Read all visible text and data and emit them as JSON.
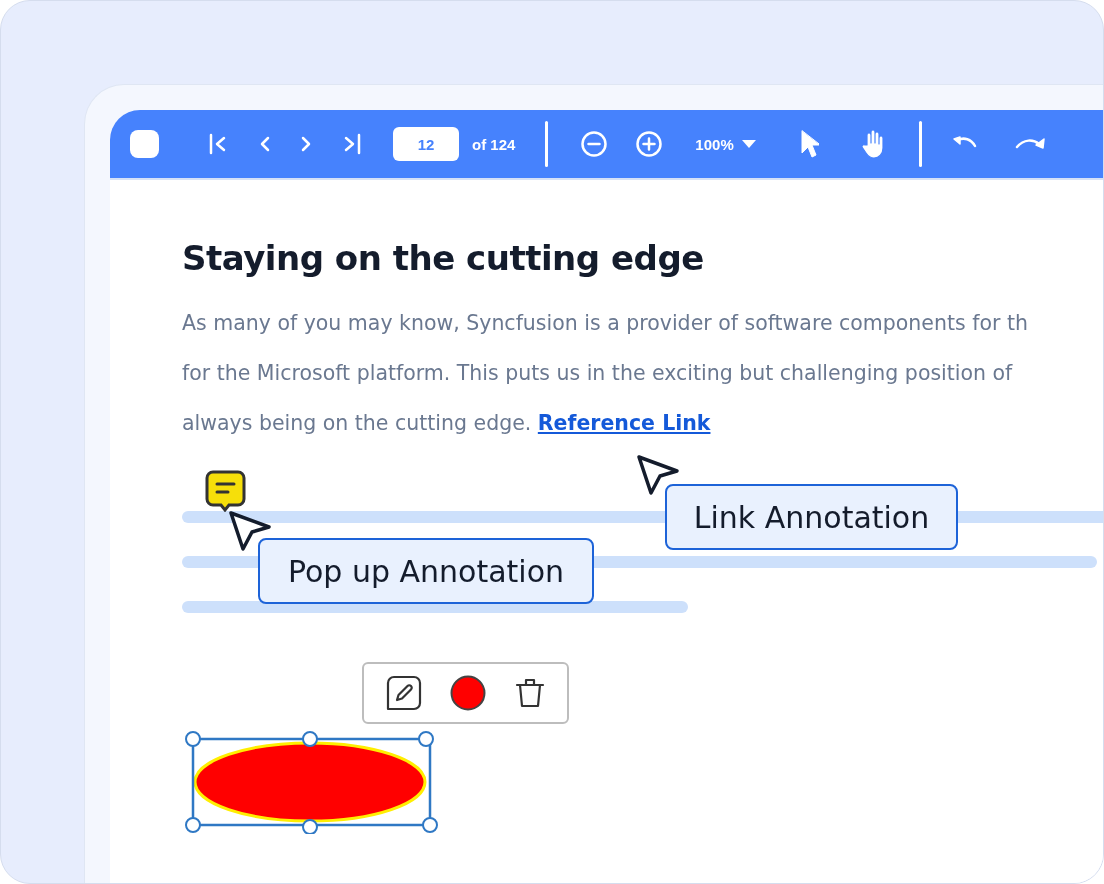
{
  "toolbar": {
    "page_input": {
      "value": "12"
    },
    "page_total": "of 124",
    "zoom": {
      "value": "100%"
    }
  },
  "document": {
    "heading": "Staying on the cutting edge",
    "paragraph_lines": [
      "As many of you may know, Syncfusion is a provider of software components for th",
      "for the Microsoft platform. This puts us in the exciting but challenging position of",
      "always being on the cutting edge."
    ],
    "link": "Reference Link"
  },
  "callouts": [
    {
      "kind": "popup",
      "label": "Pop up Annotation"
    },
    {
      "kind": "link",
      "label": "Link Annotation"
    }
  ],
  "shape_annotation": {
    "selected": true,
    "color": "#ff0000"
  }
}
